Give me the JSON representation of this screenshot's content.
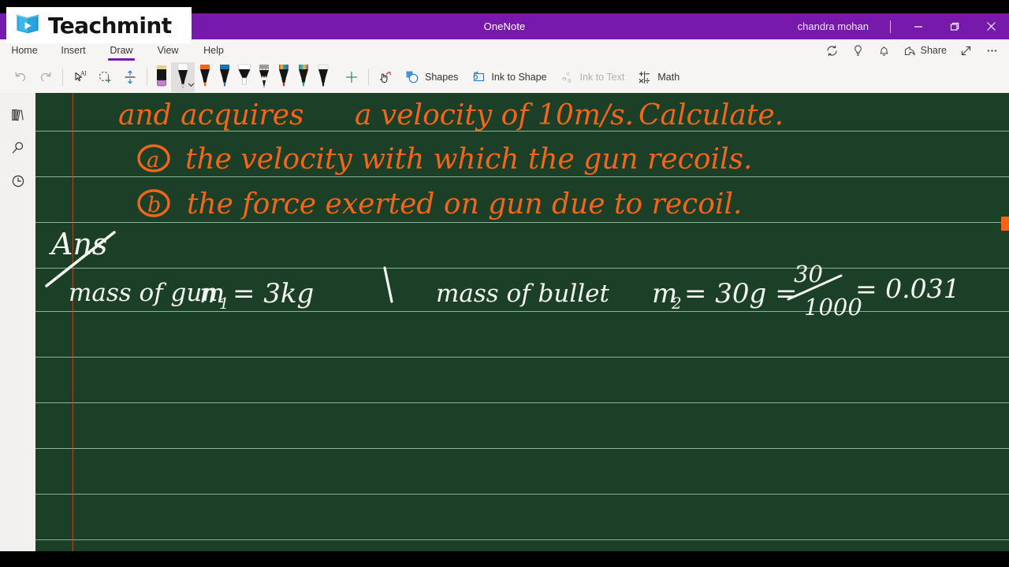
{
  "window": {
    "app_title": "OneNote",
    "user_name": "chandra mohan",
    "minimize_label": "Minimize",
    "restore_label": "Restore",
    "close_label": "Close"
  },
  "branding": {
    "name": "Teachmint",
    "logo_icon": "book-play-icon",
    "logo_color": "#29a8e0"
  },
  "ribbon": {
    "tabs": [
      {
        "label": "Home",
        "active": false
      },
      {
        "label": "Insert",
        "active": false
      },
      {
        "label": "Draw",
        "active": true
      },
      {
        "label": "View",
        "active": false
      },
      {
        "label": "Help",
        "active": false
      }
    ],
    "active_tab": "Draw",
    "accent_color": "#7719aa",
    "right_items": [
      {
        "label": "",
        "icon": "sync-icon"
      },
      {
        "label": "",
        "icon": "lightbulb-icon"
      },
      {
        "label": "",
        "icon": "bell-icon"
      },
      {
        "label": "Share",
        "icon": "share-icon"
      },
      {
        "label": "",
        "icon": "expand-icon"
      },
      {
        "label": "",
        "icon": "more-options-icon"
      }
    ],
    "share_label": "Share"
  },
  "draw_toolbar": {
    "undo_label": "Undo",
    "redo_label": "Redo",
    "lasso_text_label": "Lasso Select Text",
    "lasso_label": "Lasso Select",
    "insert_space_label": "Insert Space",
    "add_pen_label": "+",
    "touch_draw_label": "Draw with Touch",
    "pens": [
      {
        "name": "eraser",
        "body": "#1a1a1a",
        "tip": "#c77fd6",
        "cap": "#e8cf8f",
        "selected": false
      },
      {
        "name": "pen-white",
        "body": "#1a1a1a",
        "tip": "#ffffff",
        "cap": "#ffffff",
        "selected": true
      },
      {
        "name": "pen-orange",
        "body": "#1a1a1a",
        "tip": "#f4651a",
        "cap": "#f4651a",
        "selected": false
      },
      {
        "name": "pen-blue",
        "body": "#1a1a1a",
        "tip": "#1f6fb2",
        "cap": "#1f6fb2",
        "selected": false
      },
      {
        "name": "highlighter-white",
        "body": "#1a1a1a",
        "tip": "#ffffff",
        "cap": "#ffffff",
        "selected": false
      },
      {
        "name": "pencil-gray",
        "body": "#1a1a1a",
        "tip": "#6b6b6b",
        "cap": "#9a9a9a",
        "selected": false
      },
      {
        "name": "pen-rainbow-red",
        "body": "#1a1a1a",
        "tip": "#c12b2b",
        "cap": "rainbow",
        "selected": false
      },
      {
        "name": "pen-rainbow-teal",
        "body": "#1a1a1a",
        "tip": "#1f9e92",
        "cap": "rainbow",
        "selected": false
      },
      {
        "name": "pen-plain-white",
        "body": "#1a1a1a",
        "tip": "#ffffff",
        "cap": "#ffffff",
        "selected": false
      }
    ],
    "commands": [
      {
        "label": "Shapes",
        "icon": "shapes-icon",
        "disabled": false
      },
      {
        "label": "Ink to Shape",
        "icon": "ink-to-shape-icon",
        "disabled": false
      },
      {
        "label": "Ink to Text",
        "icon": "ink-to-text-icon",
        "disabled": true
      },
      {
        "label": "Math",
        "icon": "math-icon",
        "disabled": false
      }
    ]
  },
  "left_rail": {
    "items": [
      {
        "label": "Notebooks",
        "icon": "notebooks-icon"
      },
      {
        "label": "Search",
        "icon": "search-icon"
      },
      {
        "label": "Recent Notes",
        "icon": "clock-icon"
      }
    ]
  },
  "page": {
    "background_color": "#1b4027",
    "rule_line_color": "#a8d7b4",
    "margin_line_color": "#c0492e",
    "ink_colors": {
      "orange": "#f4651a",
      "white": "#f4f6f2"
    },
    "handwriting": {
      "orange_lines": [
        "and acquires   a velocity of 10m/s.  Calculate.",
        "(a) the velocity with which the gun recoils.",
        "(b) the force exerted  on gun  due to recoil."
      ],
      "white_lines": [
        "Ans",
        "mass of gun  m₁ = 3kg",
        "mass of bullet  m₂ = 30g = 30/1000 = 0.031"
      ],
      "line_1": "and acquires",
      "line_1b": "a velocity of 10m/s.",
      "line_1c": "Calculate.",
      "line_2_marker": "a",
      "line_2": "the velocity with which the gun recoils.",
      "line_3_marker": "b",
      "line_3": "the force exerted  on gun  due to recoil.",
      "ans_label": "Ans",
      "gun_mass": "mass of gun",
      "gun_mass_var": "m",
      "gun_mass_sub": "1",
      "gun_mass_val": "= 3kg",
      "bullet_mass": "mass of bullet",
      "bullet_mass_var": "m",
      "bullet_mass_sub": "2",
      "bullet_mass_val": "= 30g =",
      "fraction_num": "30",
      "fraction_den": "1000",
      "bullet_result": "= 0.031"
    }
  }
}
